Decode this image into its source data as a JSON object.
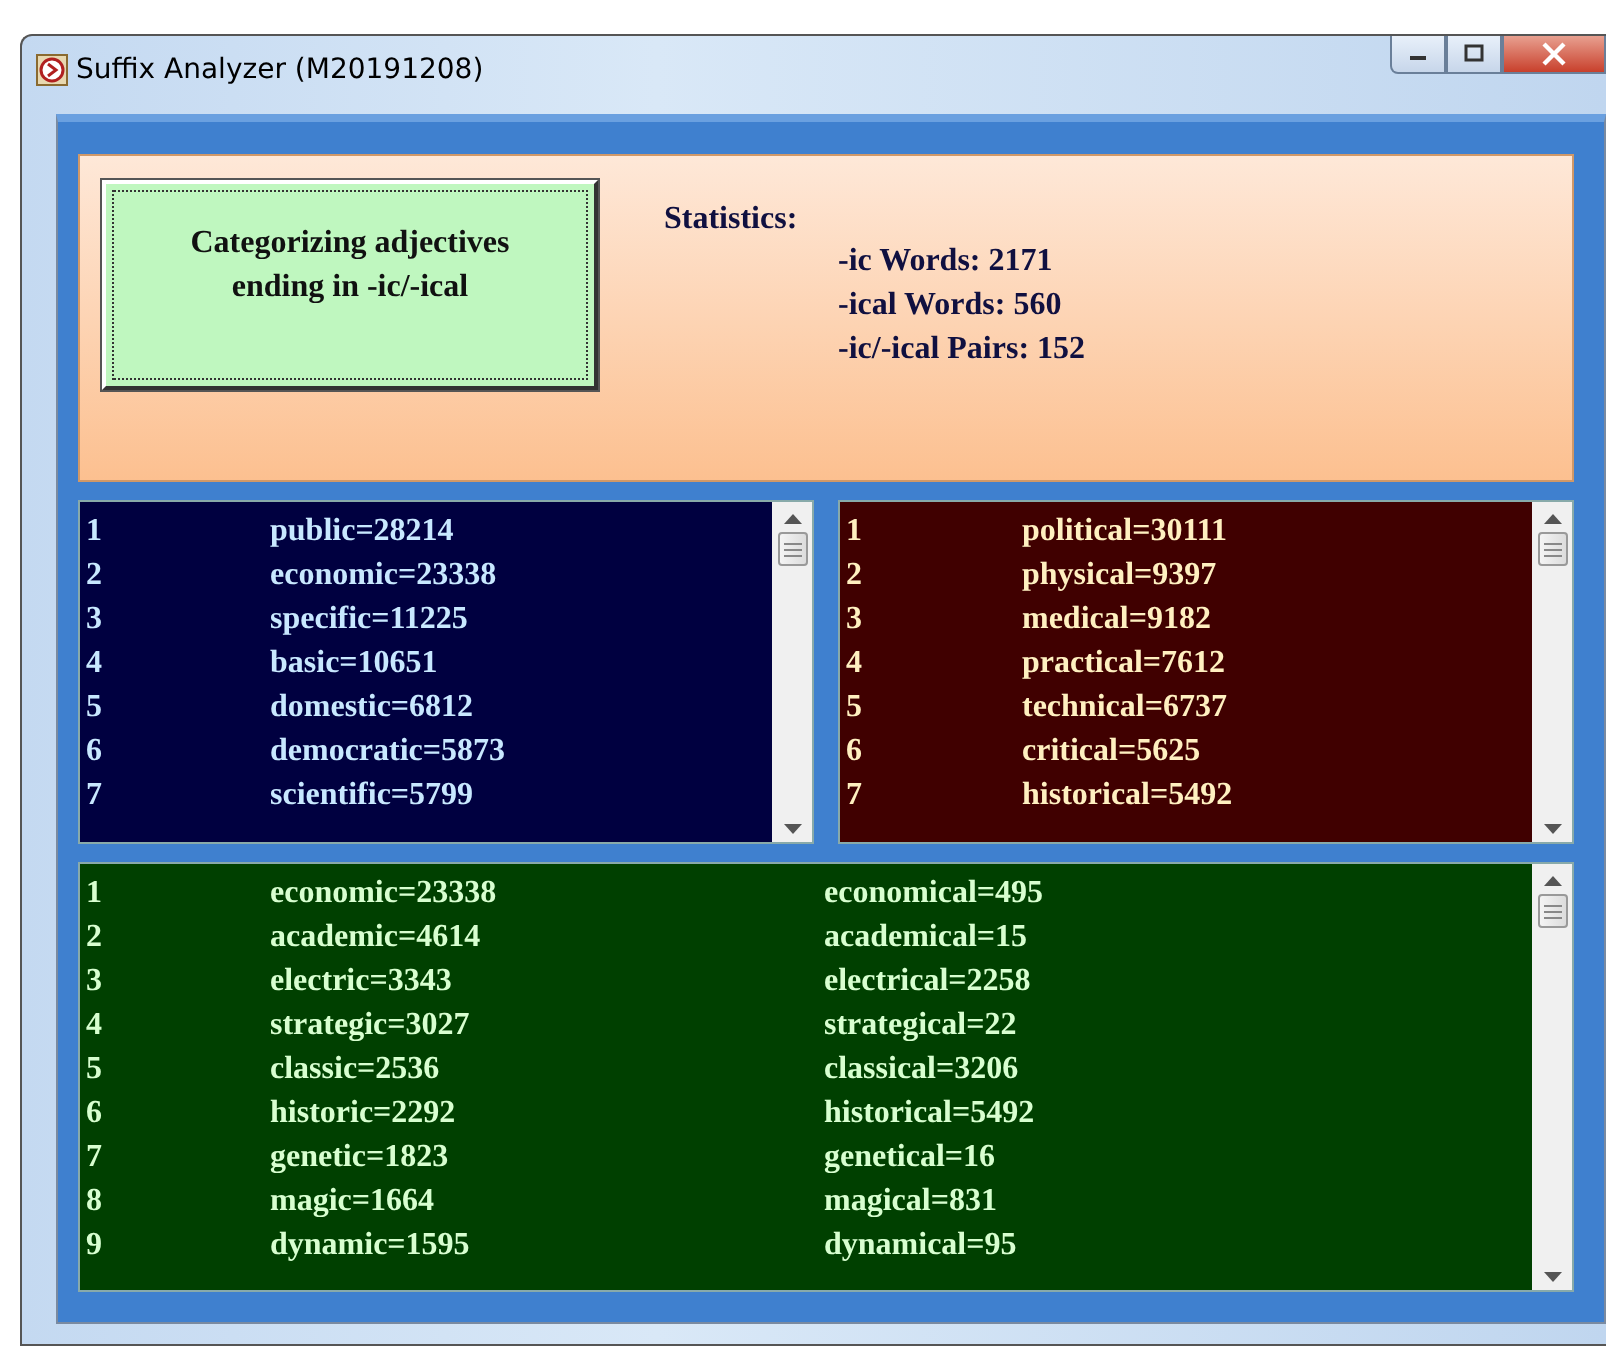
{
  "window": {
    "title": "Suffix Analyzer (M20191208)"
  },
  "header": {
    "button": "Categorizing adjectives\nending in -ic/-ical",
    "stats_title": "Statistics:",
    "stats": [
      "-ic Words: 2171",
      "-ical Words: 560",
      "-ic/-ical Pairs: 152"
    ]
  },
  "lists": [
    {
      "kind": "ic",
      "rows": [
        {
          "number": "1",
          "word": "public=28214"
        },
        {
          "number": "2",
          "word": "economic=23338"
        },
        {
          "number": "3",
          "word": "specific=11225"
        },
        {
          "number": "4",
          "word": "basic=10651"
        },
        {
          "number": "5",
          "word": "domestic=6812"
        },
        {
          "number": "6",
          "word": "democratic=5873"
        },
        {
          "number": "7",
          "word": "scientific=5799"
        }
      ]
    },
    {
      "kind": "ical",
      "rows": [
        {
          "number": "1",
          "word": "political=30111"
        },
        {
          "number": "2",
          "word": "physical=9397"
        },
        {
          "number": "3",
          "word": "medical=9182"
        },
        {
          "number": "4",
          "word": "practical=7612"
        },
        {
          "number": "5",
          "word": "technical=6737"
        },
        {
          "number": "6",
          "word": "critical=5625"
        },
        {
          "number": "7",
          "word": "historical=5492"
        }
      ]
    },
    {
      "kind": "pairs",
      "rows": [
        {
          "number": "1",
          "word": "economic=23338",
          "pair": "economical=495"
        },
        {
          "number": "2",
          "word": "academic=4614",
          "pair": "academical=15"
        },
        {
          "number": "3",
          "word": "electric=3343",
          "pair": "electrical=2258"
        },
        {
          "number": "4",
          "word": "strategic=3027",
          "pair": "strategical=22"
        },
        {
          "number": "5",
          "word": "classic=2536",
          "pair": "classical=3206"
        },
        {
          "number": "6",
          "word": "historic=2292",
          "pair": "historical=5492"
        },
        {
          "number": "7",
          "word": "genetic=1823",
          "pair": "genetical=16"
        },
        {
          "number": "8",
          "word": "magic=1664",
          "pair": "magical=831"
        },
        {
          "number": "9",
          "word": "dynamic=1595",
          "pair": "dynamical=95"
        }
      ]
    }
  ]
}
